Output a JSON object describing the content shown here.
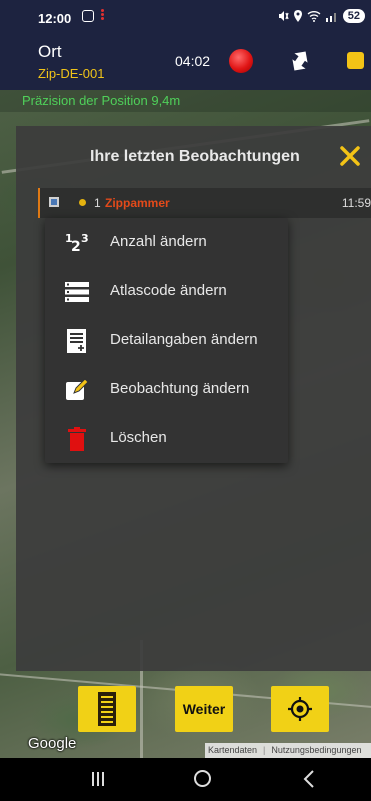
{
  "status_bar": {
    "time": "12:00",
    "battery": "52",
    "icons": [
      "screenshot-icon",
      "alert-icon",
      "mute-icon",
      "location-icon",
      "wifi-icon",
      "signal-icon"
    ]
  },
  "header": {
    "title": "Ort",
    "subtitle": "Zip-DE-001",
    "timer": "04:02",
    "icons": [
      "record-icon",
      "swap-arrows-icon",
      "stop-icon"
    ],
    "colors": {
      "background": "#1d2340",
      "subtitle": "#f0c419",
      "record": "#e01515",
      "stop": "#f3c316"
    }
  },
  "precision": {
    "text": "Präzision der Position 9,4m",
    "color": "#4fd05a"
  },
  "observations_panel": {
    "title": "Ihre letzten Beobachtungen",
    "close_icon": "close-icon",
    "items": [
      {
        "count": "1",
        "species": "Zippammer",
        "time": "11:59",
        "species_color": "#e34a1a"
      }
    ]
  },
  "context_menu": {
    "items": [
      {
        "label": "Anzahl ändern",
        "icon": "number-123-icon"
      },
      {
        "label": "Atlascode ändern",
        "icon": "list-icon"
      },
      {
        "label": "Detailangaben ändern",
        "icon": "document-add-icon"
      },
      {
        "label": "Beobachtung ändern",
        "icon": "edit-icon"
      },
      {
        "label": "Löschen",
        "icon": "trash-icon"
      }
    ]
  },
  "bottom_toolbar": {
    "weiter_label": "Weiter",
    "icons": [
      "list-view-icon",
      "locate-icon"
    ],
    "button_color": "#f1d116"
  },
  "map": {
    "logo": "Google",
    "attribution_data": "Kartendaten",
    "attribution_terms": "Nutzungsbedingungen"
  },
  "nav_bar": {
    "icons": [
      "recent-apps-icon",
      "home-icon",
      "back-icon"
    ]
  }
}
